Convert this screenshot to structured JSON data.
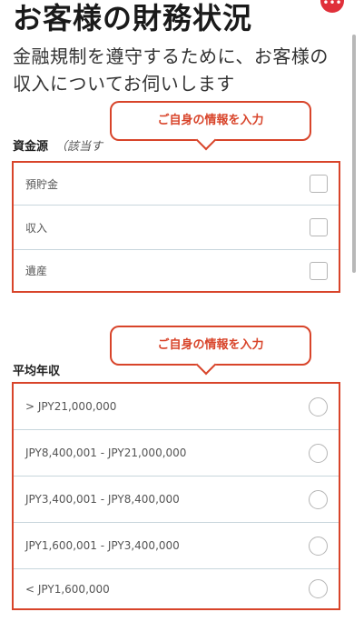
{
  "page": {
    "title": "お客様の財務状況",
    "subtitle": "金融規制を遵守するために、お客様の収入についてお伺いします",
    "menu_icon": "ellipsis-icon"
  },
  "callouts": {
    "funds": "ご自身の情報を入力",
    "income": "ご自身の情報を入力"
  },
  "funds_source": {
    "label": "資金源",
    "hint": "（該当す",
    "options": [
      "預貯金",
      "収入",
      "遺産"
    ]
  },
  "annual_income": {
    "label": "平均年収",
    "options": [
      "> JPY21,000,000",
      "JPY8,400,001 - JPY21,000,000",
      "JPY3,400,001 - JPY8,400,000",
      "JPY1,600,001 - JPY3,400,000",
      "< JPY1,600,000"
    ]
  },
  "colors": {
    "accent": "#d8442a",
    "menu_dot": "#e0303a",
    "divider": "#c8d6dc"
  }
}
